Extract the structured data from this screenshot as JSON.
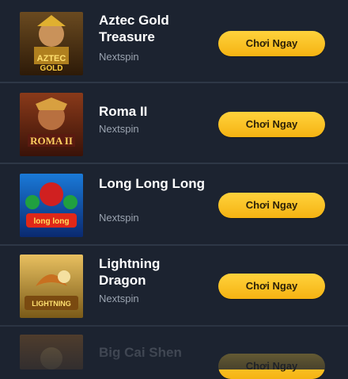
{
  "games": [
    {
      "title": "Aztec Gold Treasure",
      "provider": "Nextspin",
      "cta": "Chơi Ngay",
      "thumb_text": "AZTEC GOLD"
    },
    {
      "title": "Roma II",
      "provider": "Nextspin",
      "cta": "Chơi Ngay",
      "thumb_text": "ROMA II"
    },
    {
      "title": "Long Long Long",
      "provider": "Nextspin",
      "cta": "Chơi Ngay",
      "thumb_text": "long long long"
    },
    {
      "title": "Lightning Dragon",
      "provider": "Nextspin",
      "cta": "Chơi Ngay",
      "thumb_text": "LIGHTNING DRAGON"
    },
    {
      "title": "Big Cai Shen",
      "provider": "",
      "cta": "Chơi Ngay",
      "thumb_text": ""
    }
  ]
}
